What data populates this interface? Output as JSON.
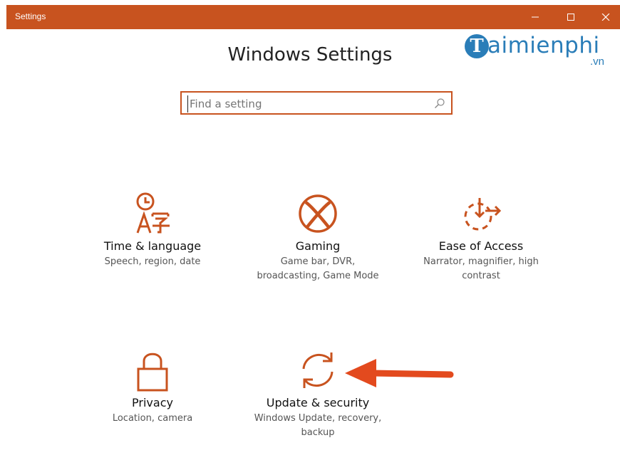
{
  "window": {
    "title": "Settings",
    "accent": "#c8531f",
    "controls": [
      "minimize-icon",
      "maximize-icon",
      "close-icon"
    ]
  },
  "header": {
    "title": "Windows Settings"
  },
  "logo": {
    "badge_letter": "T",
    "brand": "aimienphi",
    "tld": ".vn",
    "color": "#2a7db8"
  },
  "search": {
    "placeholder": "Find a setting",
    "value": "",
    "icon": "search-icon"
  },
  "tiles": [
    {
      "title": "Time & language",
      "desc_lines": [
        "Speech, region, date"
      ],
      "icon": "time-language-icon"
    },
    {
      "title": "Gaming",
      "desc_lines": [
        "Game bar, DVR,",
        "broadcasting, Game Mode"
      ],
      "icon": "xbox-icon"
    },
    {
      "title": "Ease of Access",
      "desc_lines": [
        "Narrator, magnifier, high",
        "contrast"
      ],
      "icon": "ease-of-access-icon"
    },
    {
      "title": "Privacy",
      "desc_lines": [
        "Location, camera"
      ],
      "icon": "lock-icon"
    },
    {
      "title": "Update & security",
      "desc_lines": [
        "Windows Update, recovery,",
        "backup"
      ],
      "icon": "sync-icon"
    }
  ],
  "annotation": {
    "arrow_color": "#e34a1e",
    "points_to": "Update & security"
  }
}
